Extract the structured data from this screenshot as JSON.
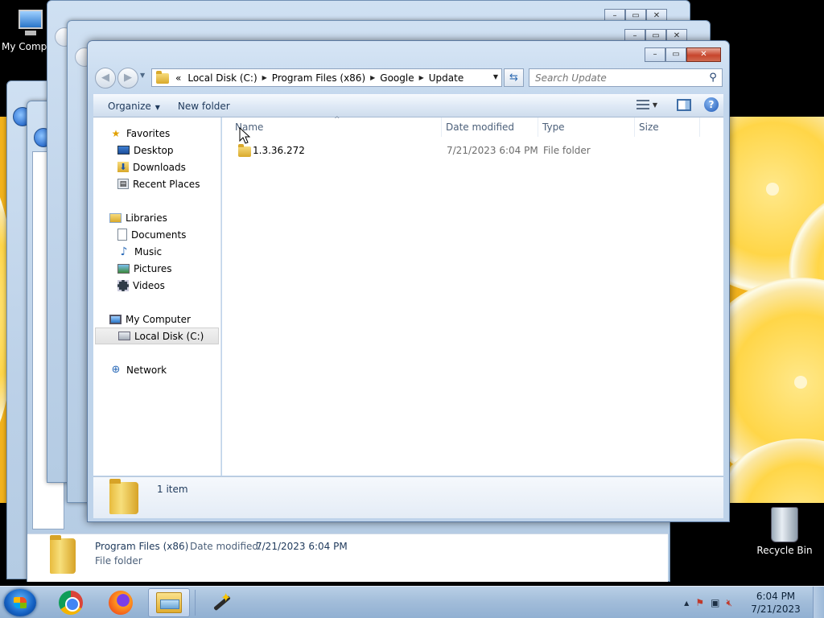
{
  "desktop": {
    "icons": {
      "my_computer": "My Computer",
      "recycle_bin": "Recycle Bin"
    }
  },
  "background_window": {
    "details": {
      "name": "Program Files (x86)",
      "date_label": "Date modified:",
      "date_value": "7/21/2023 6:04 PM",
      "type": "File folder"
    }
  },
  "window": {
    "controls": {
      "minimize": "–",
      "maximize": "▭",
      "close": "✕"
    },
    "nav": {
      "back": "◀",
      "forward": "▶",
      "history": "▼"
    },
    "address": {
      "overflow": "«",
      "crumbs": [
        "Local Disk (C:)",
        "Program Files (x86)",
        "Google",
        "Update"
      ],
      "separator": "▶",
      "dropdown": "▼"
    },
    "refresh": "⇆",
    "search": {
      "placeholder": "Search Update",
      "icon": "search-icon"
    },
    "toolbar": {
      "organize": "Organize",
      "organize_caret": "▼",
      "new_folder": "New folder",
      "views_caret": "▼",
      "help": "?"
    },
    "nav_pane": {
      "favorites": "Favorites",
      "desktop": "Desktop",
      "downloads": "Downloads",
      "recent_places": "Recent Places",
      "libraries": "Libraries",
      "documents": "Documents",
      "music": "Music",
      "pictures": "Pictures",
      "videos": "Videos",
      "my_computer": "My Computer",
      "local_disk": "Local Disk (C:)",
      "network": "Network"
    },
    "columns": {
      "sort_caret": "^",
      "name": "Name",
      "date_modified": "Date modified",
      "type": "Type",
      "size": "Size"
    },
    "files": [
      {
        "name": "1.3.36.272",
        "date_modified": "7/21/2023 6:04 PM",
        "type": "File folder",
        "size": ""
      }
    ],
    "details_pane": {
      "count": "1 item"
    }
  },
  "taskbar": {
    "tray_expand": "▲",
    "clock": {
      "time": "6:04 PM",
      "date": "7/21/2023"
    }
  },
  "colors": {
    "window_frame": "#c2d6ec",
    "accent": "#2f6bb2",
    "folder": "#e0ad30",
    "wallpaper": "#f2b21c"
  }
}
